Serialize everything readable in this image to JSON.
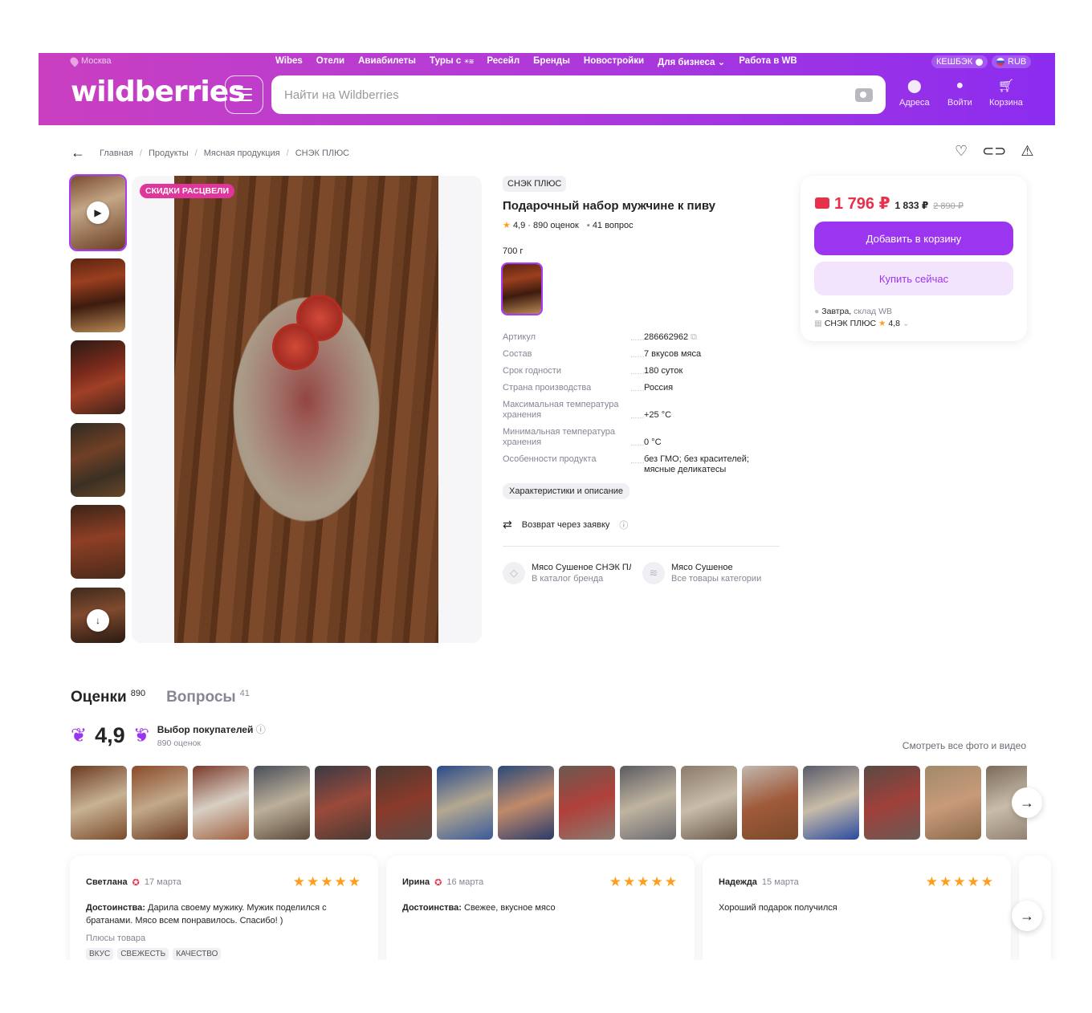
{
  "header": {
    "city": "Москва",
    "nav": [
      "Wibes",
      "Отели",
      "Авиабилеты",
      "Туры с",
      "Ресейл",
      "Бренды",
      "Новостройки",
      "Для бизнеса",
      "Работа в WB"
    ],
    "cashback": "КЕШБЭК",
    "currency": "RUB",
    "logo": "wildberries",
    "search_placeholder": "Найти на Wildberries",
    "actions": [
      {
        "label": "Адреса",
        "icon": "pin-icon"
      },
      {
        "label": "Войти",
        "icon": "user-icon"
      },
      {
        "label": "Корзина",
        "icon": "cart-icon"
      }
    ]
  },
  "breadcrumb": [
    "Главная",
    "Продукты",
    "Мясная продукция",
    "СНЭК ПЛЮС"
  ],
  "gallery": {
    "sale_badge": "СКИДКИ РАСЦВЕЛИ"
  },
  "product": {
    "brand": "СНЭК ПЛЮС",
    "title": "Подарочный набор мужчине к пиву",
    "rating": "4,9",
    "ratings_count": "890 оценок",
    "questions": "41 вопрос",
    "weight": "700 г",
    "specs": [
      {
        "k": "Артикул",
        "v": "286662962"
      },
      {
        "k": "Состав",
        "v": "7 вкусов мяса"
      },
      {
        "k": "Срок годности",
        "v": "180 суток"
      },
      {
        "k": "Страна производства",
        "v": "Россия"
      },
      {
        "k": "Максимальная температура хранения",
        "v": "+25 °C"
      },
      {
        "k": "Минимальная температура хранения",
        "v": "0 °C"
      },
      {
        "k": "Особенности продукта",
        "v": "без ГМО; без красителей; мясные деликатесы"
      }
    ],
    "char_button": "Характеристики и описание",
    "return": "Возврат через заявку",
    "links": [
      {
        "title": "Мясо Сушеное СНЭК ПЛ",
        "sub": "В каталог бренда"
      },
      {
        "title": "Мясо Сушеное",
        "sub": "Все товары категории"
      }
    ]
  },
  "price_card": {
    "price": "1 796 ₽",
    "price2": "1 833 ₽",
    "old_price": "2 890 ₽",
    "add_to_cart": "Добавить в корзину",
    "buy_now": "Купить сейчас",
    "delivery_day": "Завтра,",
    "delivery_store": "склад WB",
    "seller": "СНЭК ПЛЮС",
    "seller_rating": "4,8"
  },
  "reviews": {
    "tab_reviews": "Оценки",
    "tab_reviews_count": "890",
    "tab_questions": "Вопросы",
    "tab_questions_count": "41",
    "rating": "4,9",
    "choice": "Выбор покупателей",
    "count": "890 оценок",
    "all_photos": "Смотреть все фото и видео",
    "cards": [
      {
        "name": "Светлана",
        "date": "17 марта",
        "label": "Достоинства:",
        "text": "Дарила своему мужику. Мужик поделился с братанами. Мясо всем понравилось. Спасибо! )",
        "pluses": "Плюсы товара",
        "tags": [
          "ВКУС",
          "СВЕЖЕСТЬ",
          "КАЧЕСТВО"
        ]
      },
      {
        "name": "Ирина",
        "date": "16 марта",
        "label": "Достоинства:",
        "text": "Свежее, вкусное мясо"
      },
      {
        "name": "Надежда",
        "date": "15 марта",
        "label": "",
        "text": "Хороший подарок получился"
      }
    ]
  },
  "colors": {
    "brand_start": "#c93fc0",
    "brand_end": "#8b2cf0",
    "accent": "#9b35f0",
    "price": "#e7304b",
    "star": "#ff9d1c"
  }
}
